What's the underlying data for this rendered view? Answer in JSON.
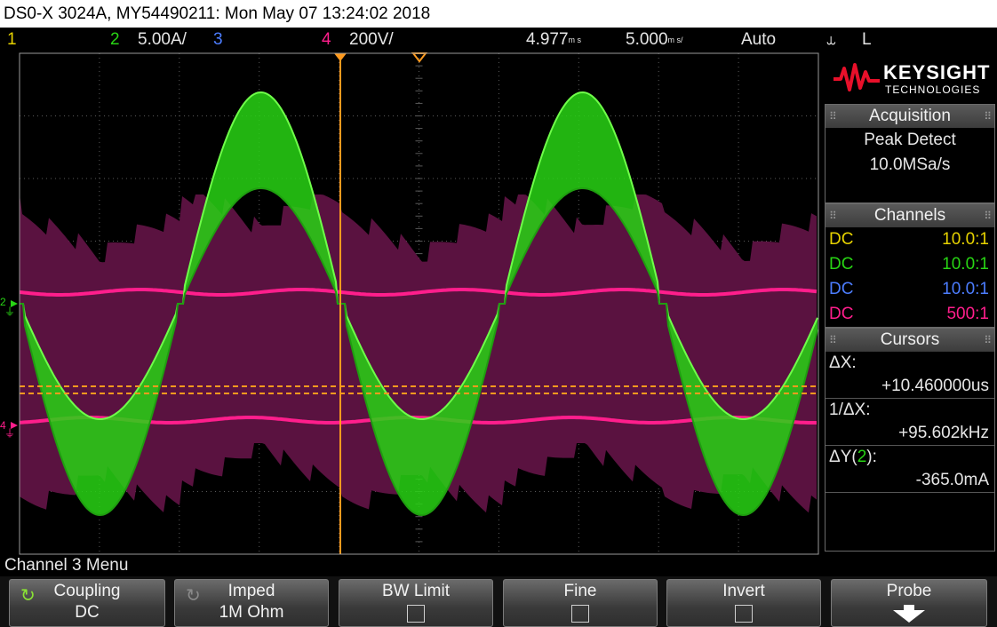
{
  "window": {
    "title": "DS0-X 3024A, MY54490211: Mon May 07 13:24:02 2018"
  },
  "statusbar": {
    "ch1_num": "1",
    "ch2_num": "2",
    "ch2_scale": "5.00A/",
    "ch3_num": "3",
    "ch4_num": "4",
    "ch4_scale": "200V/",
    "time_pos": "4.977",
    "time_pos_unit": "m s",
    "time_scale": "5.000",
    "time_scale_unit": "m s/",
    "trigger_mode": "Auto",
    "trigger_slope_symbol": "⥿",
    "trigger_source": "L"
  },
  "screen": {
    "ch2_marker": "2",
    "ch4_marker": "4"
  },
  "sidepanel": {
    "brand": "KEYSIGHT",
    "brand_sub": "TECHNOLOGIES",
    "acquisition": {
      "title": "Acquisition",
      "mode": "Peak Detect",
      "rate": "10.0MSa/s"
    },
    "channels": {
      "title": "Channels",
      "rows": [
        {
          "coupling": "DC",
          "probe": "10.0:1",
          "color": "#e6d200"
        },
        {
          "coupling": "DC",
          "probe": "10.0:1",
          "color": "#28d414"
        },
        {
          "coupling": "DC",
          "probe": "10.0:1",
          "color": "#4c7dff"
        },
        {
          "coupling": "DC",
          "probe": "500:1",
          "color": "#ff1e8c"
        }
      ]
    },
    "cursors": {
      "title": "Cursors",
      "dx_label": "ΔX:",
      "dx_value": "+10.460000us",
      "inv_dx_label": "1/ΔX:",
      "inv_dx_value": "+95.602kHz",
      "dy_label_pre": "ΔY(",
      "dy_label_ch": "2",
      "dy_label_post": "):",
      "dy_value": "-365.0mA"
    }
  },
  "menu": {
    "title": "Channel 3 Menu",
    "softkeys": [
      {
        "label": "Coupling",
        "value": "DC"
      },
      {
        "label": "Imped",
        "value": "1M Ohm"
      },
      {
        "label": "BW Limit"
      },
      {
        "label": "Fine"
      },
      {
        "label": "Invert"
      },
      {
        "label": "Probe"
      }
    ]
  },
  "colors": {
    "ch1": "#e6d200",
    "ch2": "#28d414",
    "ch3": "#4c7dff",
    "ch4": "#ff1e8c",
    "ch4_envelope": "#5a1240",
    "cursor": "#ff9a1e",
    "grid": "#5a5a5a"
  }
}
